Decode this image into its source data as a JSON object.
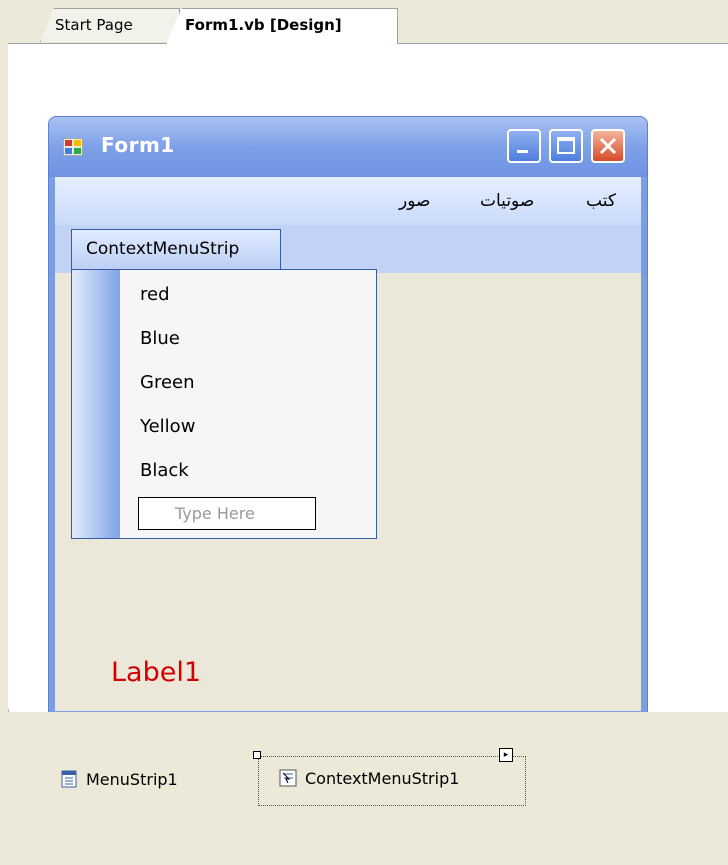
{
  "tabs": [
    {
      "label": "Start Page"
    },
    {
      "label": "Form1.vb [Design]"
    }
  ],
  "form": {
    "title": "Form1",
    "menu": [
      "كتب",
      "صوتيات",
      "صور"
    ],
    "context_menu_strip_label": "ContextMenuStrip",
    "context_items": [
      "red",
      "Blue",
      "Green",
      "Yellow",
      "Black"
    ],
    "type_here_placeholder": "Type Here",
    "label": "Label1"
  },
  "tray": {
    "menustrip": "MenuStrip1",
    "contextmenustrip": "ContextMenuStrip1"
  },
  "colors": {
    "label_color": "#d40000",
    "title_bar": "#7b9ee3"
  }
}
